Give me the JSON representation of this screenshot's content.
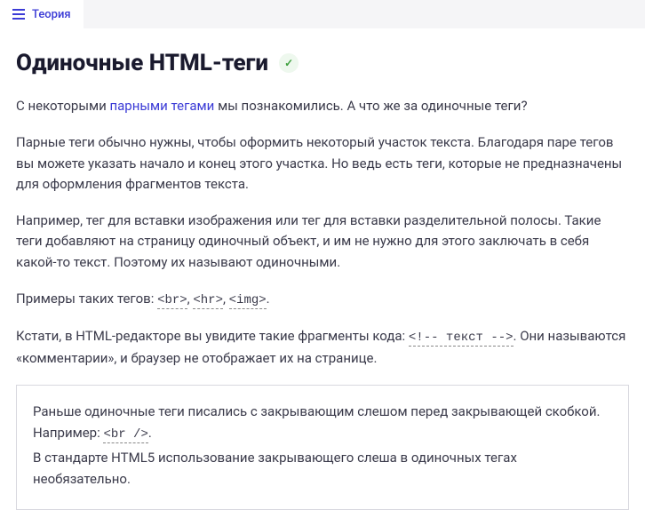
{
  "topbar": {
    "tab_label": "Теория"
  },
  "page": {
    "title": "Одиночные HTML-теги",
    "check_glyph": "✓"
  },
  "para1": {
    "t1": "С некоторыми ",
    "link": "парными тегами",
    "t2": " мы познакомились. А что же за одиночные теги?"
  },
  "para2": "Парные теги обычно нужны, чтобы оформить некоторый участок текста. Благодаря паре тегов вы можете указать начало и конец этого участка. Но ведь есть теги, которые не предназначены для оформления фрагментов текста.",
  "para3": "Например, тег для вставки изображения или тег для вставки разделительной полосы. Такие теги добавляют на страницу одиночный объект, и им не нужно для этого заключать в себя какой-то текст. Поэтому их называют одиночными.",
  "para4": {
    "t1": "Примеры таких тегов: ",
    "c1": "<br>",
    "sep1": ", ",
    "c2": "<hr>",
    "sep2": ", ",
    "c3": "<img>",
    "t2": "."
  },
  "para5": {
    "t1": "Кстати, в HTML-редакторе вы увидите такие фрагменты кода: ",
    "c1": "<!-- текст -->",
    "t2": ". Они называются «комментарии», и браузер не отображает их на странице."
  },
  "note": {
    "l1a": "Раньше одиночные теги писались с закрывающим слешом перед закрывающей скобкой. Например: ",
    "l1code": "<br />",
    "l1b": ".",
    "l2": "В стандарте HTML5 использование закрывающего слеша в одиночных тегах необязательно."
  }
}
